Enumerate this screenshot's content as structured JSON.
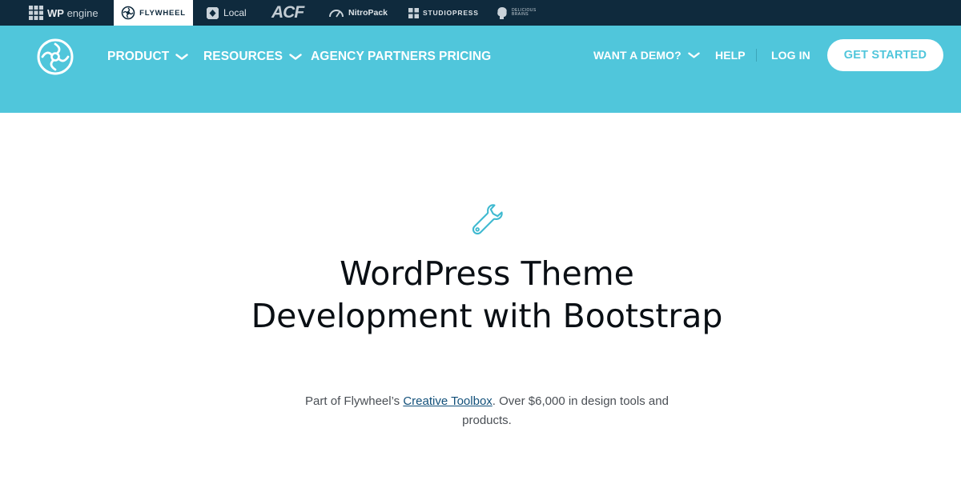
{
  "brand_bar": {
    "wpengine": {
      "bold": "WP",
      "rest": "engine",
      "icon": "wpengine-grid-icon"
    },
    "flywheel": {
      "label": "FLYWHEEL",
      "icon": "flywheel-icon",
      "active": true
    },
    "local": {
      "label": "Local",
      "icon": "local-icon"
    },
    "acf": {
      "label": "ACF"
    },
    "nitropack": {
      "label": "NitroPack",
      "icon": "gauge-icon"
    },
    "studiopress": {
      "label": "STUDIOPRESS",
      "icon": "studiopress-icon"
    },
    "delicious": {
      "label": "DELICIOUS BRAINS",
      "icon": "brain-icon"
    }
  },
  "header": {
    "nav": [
      {
        "label": "PRODUCT",
        "has_dropdown": true
      },
      {
        "label": "RESOURCES",
        "has_dropdown": true
      },
      {
        "label": "AGENCY PARTNERS",
        "has_dropdown": false
      },
      {
        "label": "PRICING",
        "has_dropdown": false
      }
    ],
    "right": {
      "demo": "WANT A DEMO?",
      "help": "HELP",
      "login": "LOG IN",
      "cta": "GET STARTED"
    }
  },
  "hero": {
    "icon": "wrench-icon",
    "title": "WordPress Theme Development with Bootstrap",
    "subtitle_before": "Part of Flywheel’s ",
    "subtitle_link": "Creative Toolbox",
    "subtitle_after": ". Over $6,000 in design tools and products."
  },
  "colors": {
    "brand_bar": "#0f2a3d",
    "header": "#50c6db",
    "cta_text": "#50c6db",
    "title": "#0a0f14",
    "link": "#12507a"
  }
}
